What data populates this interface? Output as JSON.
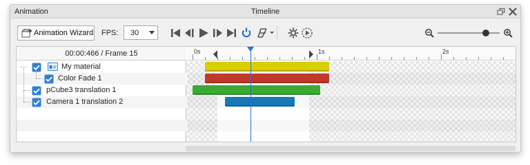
{
  "titlebar": {
    "panel_name": "Animation",
    "window_title": "Timeline",
    "restore_icon": "restore-window-icon",
    "close_icon": "close-icon"
  },
  "toolbar": {
    "wizard_label": "Animation Wizard",
    "wizard_icon": "wizard-icon",
    "fps_label": "FPS:",
    "fps_value": "30",
    "icons": [
      "go-to-start-icon",
      "step-back-icon",
      "play-icon",
      "step-forward-icon",
      "go-to-end-icon",
      "loop-icon",
      "curve-menu-icon",
      "settings-icon",
      "preview-icon",
      "zoom-out-icon",
      "zoom-in-icon"
    ],
    "zoom_level": 0.78
  },
  "tree": {
    "header": "00:00:466 / Frame 15",
    "rows": [
      {
        "label": "My material",
        "checked": true
      },
      {
        "label": "Color Fade 1",
        "checked": true
      },
      {
        "label": "pCube3 translation 1",
        "checked": true
      },
      {
        "label": "Camera 1 translation 2",
        "checked": true
      }
    ]
  },
  "timeline": {
    "ruler_labels": [
      "0s",
      "1s",
      "2s"
    ],
    "current_time_s": 0.466,
    "range_start_s": 0.2,
    "range_end_s": 0.94,
    "tracks": [
      {
        "start_s": 0.1,
        "end_s": 1.1,
        "color": "#d9cf00"
      },
      {
        "start_s": 0.1,
        "end_s": 1.1,
        "color": "#c0392b"
      },
      {
        "start_s": 0.0,
        "end_s": 1.03,
        "color": "#3aa935"
      },
      {
        "start_s": 0.26,
        "end_s": 0.82,
        "color": "#1778b8"
      }
    ]
  },
  "colors": {
    "accent": "#2a6fd6",
    "checkbox": "#2f7fd8"
  }
}
